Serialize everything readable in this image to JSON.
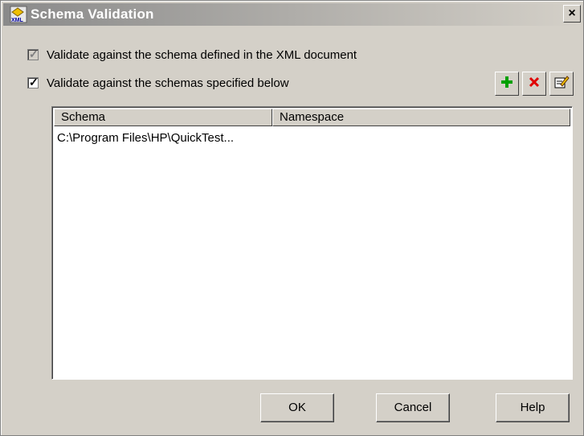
{
  "window": {
    "title": "Schema Validation",
    "icon": "xml-schema-icon",
    "close_label": "×"
  },
  "options": {
    "validate_document": {
      "label": "Validate against the schema defined in the XML document",
      "checked": true,
      "enabled": false
    },
    "validate_specified": {
      "label": "Validate against the schemas specified below",
      "checked": true,
      "enabled": true
    }
  },
  "toolbar": {
    "add_icon": "plus-icon",
    "delete_icon": "x-icon",
    "edit_icon": "edit-icon",
    "colors": {
      "add": "#00a000",
      "delete": "#e00000"
    }
  },
  "table": {
    "columns": [
      "Schema",
      "Namespace"
    ],
    "rows": [
      {
        "schema": "C:\\Program Files\\HP\\QuickTest...",
        "namespace": ""
      }
    ]
  },
  "buttons": {
    "ok": "OK",
    "cancel": "Cancel",
    "help": "Help"
  }
}
